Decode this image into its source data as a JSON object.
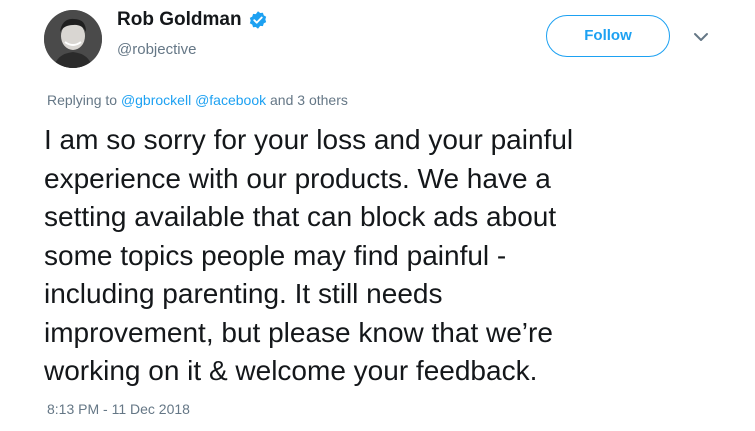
{
  "author": {
    "name": "Rob Goldman",
    "handle": "@robjective",
    "verified": true
  },
  "follow_button": {
    "label": "Follow"
  },
  "replying": {
    "prefix": "Replying to",
    "mentions": [
      "@gbrockell",
      "@facebook"
    ],
    "suffix": "and 3 others"
  },
  "tweet": {
    "lines": [
      "I am so sorry for your loss and your painful",
      "experience with our products. We have a",
      "setting available that can block ads about",
      "some topics people may find painful -",
      "including parenting. It still needs",
      "improvement, but please know that we’re",
      "working on it & welcome your feedback."
    ]
  },
  "timestamp": "8:13 PM - 11 Dec 2018",
  "colors": {
    "accent": "#1da1f2",
    "text": "#14171a",
    "muted": "#657786"
  },
  "icons": {
    "verified": "verified-badge-icon",
    "caret": "chevron-down-icon"
  }
}
